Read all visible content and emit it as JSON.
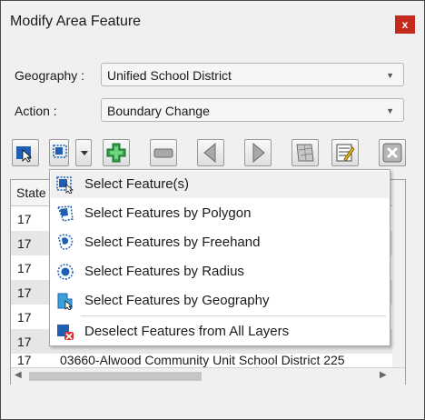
{
  "window": {
    "title": "Modify Area Feature",
    "close_label": "x"
  },
  "form": {
    "geography": {
      "label": "Geography :",
      "value": "Unified School District"
    },
    "action": {
      "label": "Action :",
      "value": "Boundary Change"
    }
  },
  "toolbar": {
    "buttons": [
      "select-tool-icon",
      "select-dropdown-icon",
      "add-icon",
      "remove-icon",
      "previous-icon",
      "next-icon",
      "map-icon",
      "edit-table-icon",
      "cancel-icon"
    ]
  },
  "grid": {
    "column_header": "State",
    "rows": [
      {
        "state": "17",
        "name": ""
      },
      {
        "state": "17",
        "name": ""
      },
      {
        "state": "17",
        "name": ""
      },
      {
        "state": "17",
        "name": ""
      },
      {
        "state": "17",
        "name": ""
      },
      {
        "state": "17",
        "name": ""
      },
      {
        "state": "17",
        "name": "03660-Alwood Community Unit School District 225"
      }
    ]
  },
  "menu": {
    "items": [
      {
        "label": "Select Feature(s)",
        "icon": "select-feature-icon"
      },
      {
        "label": "Select Features by Polygon",
        "icon": "select-polygon-icon"
      },
      {
        "label": "Select Features by Freehand",
        "icon": "select-freehand-icon"
      },
      {
        "label": "Select Features by Radius",
        "icon": "select-radius-icon"
      },
      {
        "label": "Select Features by Geography",
        "icon": "select-geography-icon"
      },
      {
        "label": "Deselect Features from All Layers",
        "icon": "deselect-icon"
      }
    ]
  },
  "colors": {
    "close": "#c42b1c",
    "accent_blue": "#1e5fb4",
    "add_green": "#2ea043"
  }
}
